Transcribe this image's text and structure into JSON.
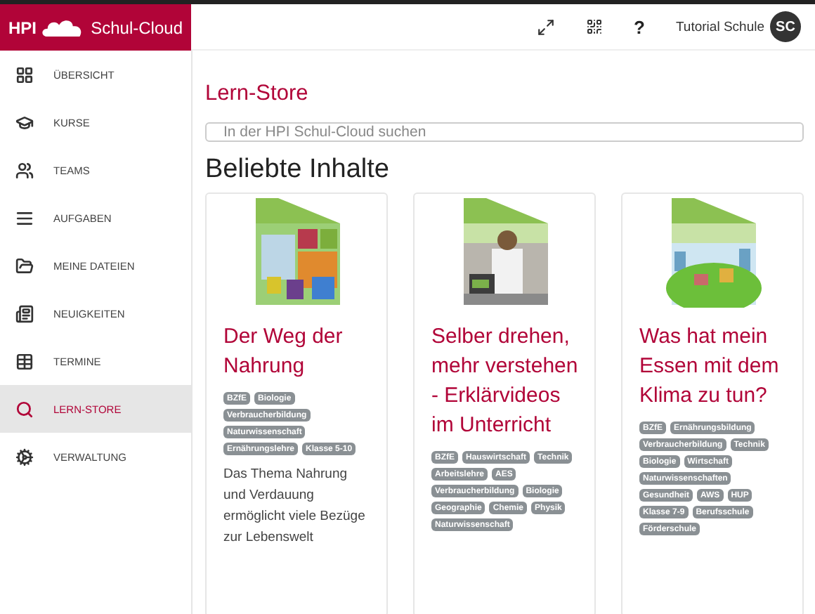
{
  "logo": {
    "abbr": "HPI",
    "name": "Schul-Cloud"
  },
  "header": {
    "user": "Tutorial Schule",
    "initials": "SC",
    "help": "?"
  },
  "sidebar": {
    "items": [
      {
        "label": "ÜBERSICHT",
        "selected": false
      },
      {
        "label": "KURSE",
        "selected": false
      },
      {
        "label": "TEAMS",
        "selected": false
      },
      {
        "label": "AUFGABEN",
        "selected": false
      },
      {
        "label": "MEINE DATEIEN",
        "selected": false
      },
      {
        "label": "NEUIGKEITEN",
        "selected": false
      },
      {
        "label": "TERMINE",
        "selected": false
      },
      {
        "label": "LERN-STORE",
        "selected": true
      },
      {
        "label": "VERWALTUNG",
        "selected": false
      }
    ]
  },
  "page_title": "Lern-Store",
  "search": {
    "placeholder": "In der HPI Schul-Cloud suchen"
  },
  "section_title": "Beliebte Inhalte",
  "cards": [
    {
      "title": "Der Weg der Nahrung",
      "tags": [
        "BZfE",
        "Biologie",
        "Verbraucherbildung",
        "Naturwissenschaft",
        "Ernährungslehre",
        "Klasse 5-10"
      ],
      "description": "Das Thema Nahrung und Verdauung ermöglicht viele Bezüge zur Lebenswelt"
    },
    {
      "title": "Selber drehen, mehr verstehen - Erklärvideos im Unterricht",
      "tags": [
        "BZfE",
        "Hauswirtschaft",
        "Technik",
        "Arbeitslehre",
        "AES",
        "Verbraucherbildung",
        "Biologie",
        "Geographie",
        "Chemie",
        "Physik",
        "Naturwissenschaft"
      ]
    },
    {
      "title": "Was hat mein Essen mit dem Klima zu tun?",
      "tags": [
        "BZfE",
        "Ernährungsbildung",
        "Verbraucherbildung",
        "Technik",
        "Biologie",
        "Wirtschaft",
        "Naturwissenschaften",
        "Gesundheit",
        "AWS",
        "HUP",
        "Klasse 7-9",
        "Berufsschule",
        "Förderschule"
      ]
    }
  ]
}
